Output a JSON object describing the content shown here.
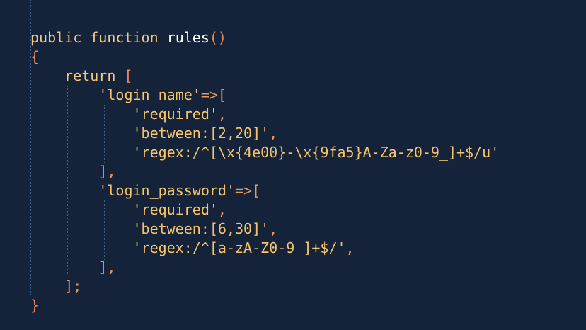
{
  "colors": {
    "background": "#15233a",
    "keyword": "#f3c77d",
    "function_name": "#ffffff",
    "bracket": "#ee8656",
    "string": "#f7c46c",
    "punctuation": "#e89a5b",
    "indent_guide": "#3d5f8c"
  },
  "code": {
    "kw_public": "public",
    "kw_function": "function",
    "fn_name": "rules",
    "fn_parens": "()",
    "open_brace": "{",
    "kw_return": "return",
    "open_bracket": "[",
    "key_login_name": "'login_name'",
    "arrow_1": "=>[",
    "rule_required_1": "'required'",
    "rule_between_1": "'between:[2,20]'",
    "rule_regex_1": "'regex:/^[\\x{4e00}-\\x{9fa5}A-Za-z0-9_]+$/u'",
    "close_1": "],",
    "key_login_password": "'login_password'",
    "arrow_2": "=>[",
    "rule_required_2": "'required'",
    "rule_between_2": "'between:[6,30]'",
    "rule_regex_2": "'regex:/^[a-zA-Z0-9_]+$/'",
    "close_2": "],",
    "close_return": "];",
    "close_brace": "}",
    "comma": ","
  }
}
